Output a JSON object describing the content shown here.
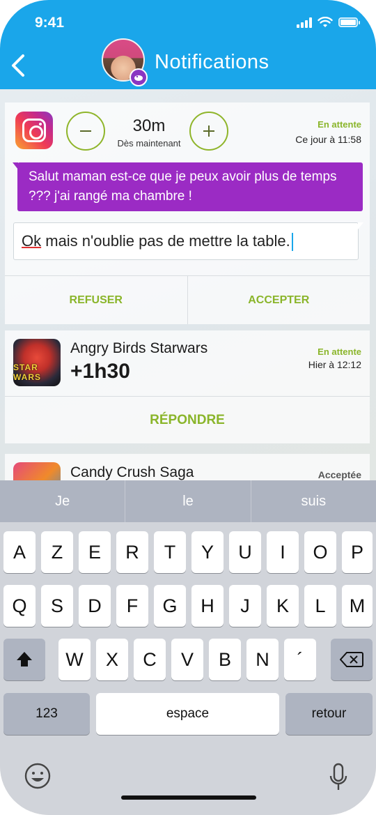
{
  "status_bar": {
    "time": "9:41"
  },
  "header": {
    "title": "Notifications"
  },
  "card1": {
    "duration": "30m",
    "duration_sub": "Dès maintenant",
    "status": "En attente",
    "time": "Ce jour à 11:58",
    "message": "Salut maman est-ce que je peux avoir plus de temps ??? j'ai rangé ma chambre !",
    "reply_first": "Ok",
    "reply_rest": " mais n'oublie pas de mettre la table.",
    "refuse_label": "REFUSER",
    "accept_label": "ACCEPTER"
  },
  "card2": {
    "app_name": "Angry Birds Starwars",
    "icon_text": "STAR WARS",
    "request": "+1h30",
    "status": "En attente",
    "time": "Hier à 12:12",
    "respond_label": "RÉPONDRE"
  },
  "card3": {
    "app_name": "Candy Crush Saga",
    "status": "Acceptée"
  },
  "keyboard": {
    "suggestions": [
      "Je",
      "le",
      "suis"
    ],
    "row1": [
      "A",
      "Z",
      "E",
      "R",
      "T",
      "Y",
      "U",
      "I",
      "O",
      "P"
    ],
    "row2": [
      "Q",
      "S",
      "D",
      "F",
      "G",
      "H",
      "J",
      "K",
      "L",
      "M"
    ],
    "row3": [
      "W",
      "X",
      "C",
      "V",
      "B",
      "N",
      "´"
    ],
    "numbers_label": "123",
    "space_label": "espace",
    "return_label": "retour"
  },
  "colors": {
    "header": "#1aa6ea",
    "accent_green": "#8ab52a",
    "bubble_purple": "#9b2bc4"
  },
  "icons": [
    "back-chevron",
    "minus",
    "plus",
    "shift",
    "backspace",
    "emoji",
    "microphone",
    "instagram"
  ]
}
